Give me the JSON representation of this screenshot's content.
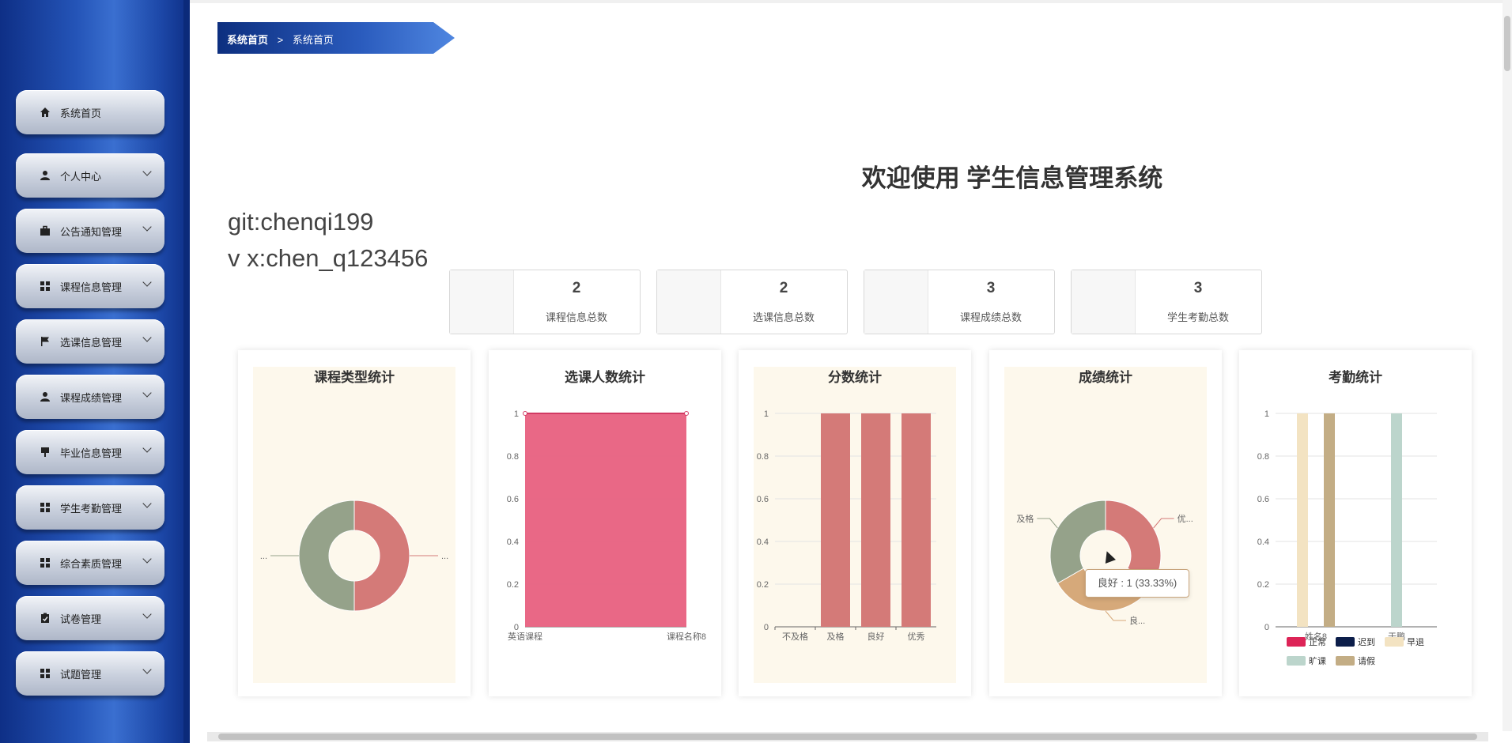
{
  "sidebar": {
    "items": [
      {
        "label": "系统首页",
        "icon": "home-icon",
        "expandable": false
      },
      {
        "label": "个人中心",
        "icon": "user-icon",
        "expandable": true
      },
      {
        "label": "公告通知管理",
        "icon": "briefcase-icon",
        "expandable": true
      },
      {
        "label": "课程信息管理",
        "icon": "grid-icon",
        "expandable": true
      },
      {
        "label": "选课信息管理",
        "icon": "flag-icon",
        "expandable": true
      },
      {
        "label": "课程成绩管理",
        "icon": "user-icon",
        "expandable": true
      },
      {
        "label": "毕业信息管理",
        "icon": "pin-icon",
        "expandable": true
      },
      {
        "label": "学生考勤管理",
        "icon": "grid-icon",
        "expandable": true
      },
      {
        "label": "综合素质管理",
        "icon": "grid-icon",
        "expandable": true
      },
      {
        "label": "试卷管理",
        "icon": "clipboard-icon",
        "expandable": true
      },
      {
        "label": "试题管理",
        "icon": "grid-icon",
        "expandable": true
      }
    ]
  },
  "breadcrumb": {
    "home": "系统首页",
    "separator": ">",
    "current": "系统首页"
  },
  "welcome": "欢迎使用 学生信息管理系统",
  "contact": {
    "git": "git:chenqi199",
    "wx": "v x:chen_q123456"
  },
  "stats": [
    {
      "value": "2",
      "label": "课程信息总数"
    },
    {
      "value": "2",
      "label": "选课信息总数"
    },
    {
      "value": "3",
      "label": "课程成绩总数"
    },
    {
      "value": "3",
      "label": "学生考勤总数"
    }
  ],
  "cards": {
    "course_type": {
      "title": "课程类型统计"
    },
    "enrollment": {
      "title": "选课人数统计"
    },
    "scores": {
      "title": "分数统计"
    },
    "grades": {
      "title": "成绩统计"
    },
    "attendance": {
      "title": "考勤统计"
    }
  },
  "colors": {
    "accent": "#1c47a7",
    "pink": "#e8607f",
    "bar": "#d47a78",
    "green": "#95a28a",
    "tan": "#d6a97a",
    "beige": "#f3e3c2",
    "brown": "#c3ad85",
    "teal": "#bcd5cc",
    "navy": "#0c1e4a",
    "crimson": "#dd2457"
  },
  "tooltip": "良好 : 1 (33.33%)",
  "chart_data": [
    {
      "type": "pie",
      "title": "课程类型统计",
      "labels": [
        "...",
        "..."
      ],
      "values": [
        1,
        1
      ],
      "donut": true
    },
    {
      "type": "area",
      "title": "选课人数统计",
      "categories": [
        "英语课程",
        "课程名称8"
      ],
      "values": [
        1,
        1
      ],
      "ylim": [
        0,
        1
      ],
      "yticks": [
        "0",
        "0.2",
        "0.4",
        "0.6",
        "0.8",
        "1"
      ]
    },
    {
      "type": "bar",
      "title": "分数统计",
      "categories": [
        "不及格",
        "及格",
        "良好",
        "优秀"
      ],
      "values": [
        0,
        1,
        1,
        1
      ],
      "ylim": [
        0,
        1
      ],
      "yticks": [
        "0",
        "0.2",
        "0.4",
        "0.6",
        "0.8",
        "1"
      ]
    },
    {
      "type": "pie",
      "title": "成绩统计",
      "labels": [
        "优...",
        "良...",
        "及格"
      ],
      "values": [
        1,
        1,
        1
      ],
      "donut": true
    },
    {
      "type": "bar",
      "title": "考勤统计",
      "categories": [
        "姓名8",
        "于鹏"
      ],
      "series": [
        {
          "name": "正常",
          "values": [
            0,
            0
          ]
        },
        {
          "name": "迟到",
          "values": [
            0,
            0
          ]
        },
        {
          "name": "早退",
          "values": [
            1,
            0
          ]
        },
        {
          "name": "旷课",
          "values": [
            0,
            1
          ]
        },
        {
          "name": "请假",
          "values": [
            1,
            0
          ]
        }
      ],
      "ylim": [
        0,
        1
      ],
      "yticks": [
        "0",
        "0.2",
        "0.4",
        "0.6",
        "0.8",
        "1"
      ],
      "legend": "bottom"
    }
  ]
}
